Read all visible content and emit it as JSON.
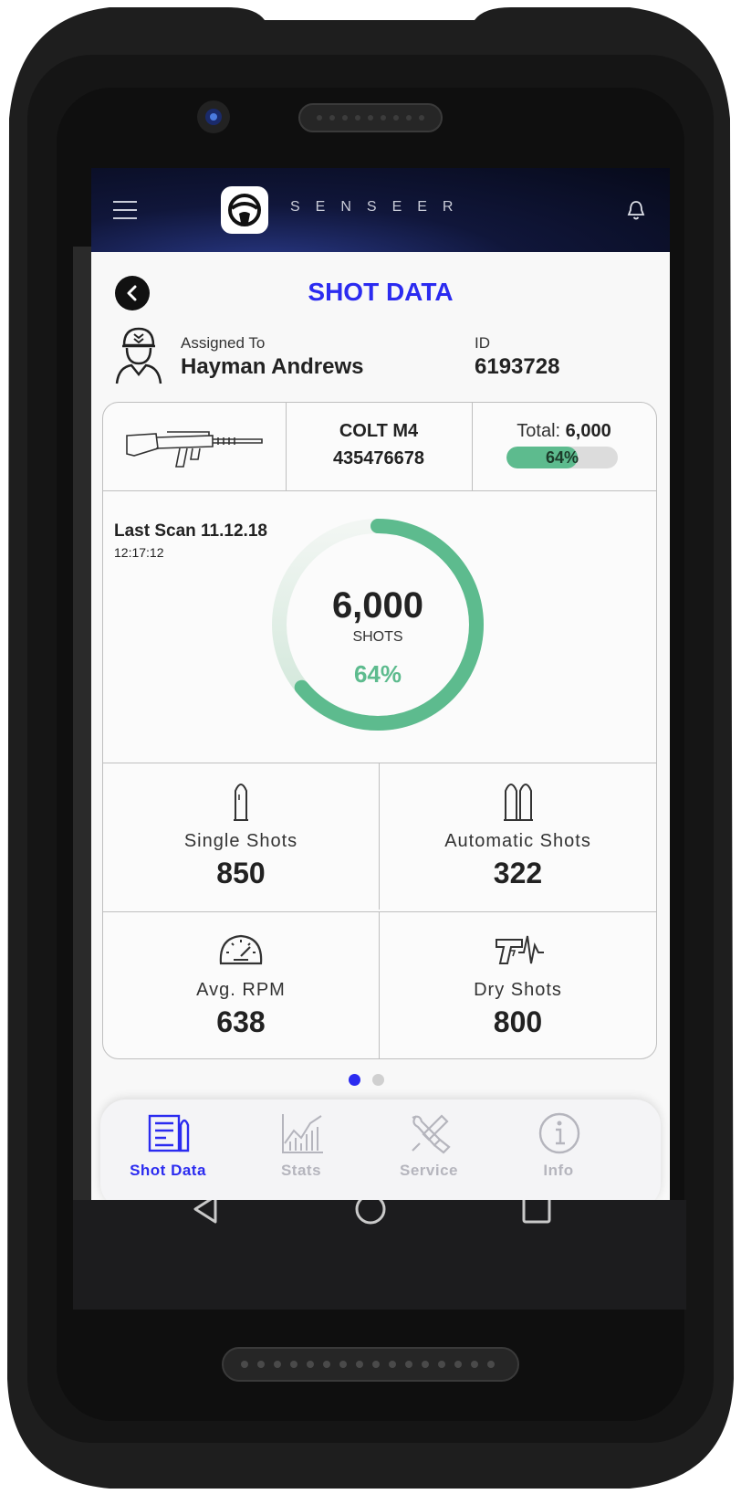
{
  "header": {
    "brand": "SENSEER"
  },
  "page": {
    "title": "SHOT DATA"
  },
  "assigned": {
    "label": "Assigned To",
    "name": "Hayman Andrews",
    "id_label": "ID",
    "id_value": "6193728"
  },
  "weapon": {
    "model": "COLT M4",
    "serial": "435476678",
    "total_label": "Total:",
    "total_value": "6,000",
    "progress_label": "64%",
    "progress": 0.64
  },
  "scan": {
    "title": "Last Scan 11.12.18",
    "time": "12:17:12"
  },
  "ring": {
    "value": "6,000",
    "unit": "SHOTS",
    "percent_label": "64%",
    "percent": 0.64
  },
  "stats": [
    {
      "label": "Single Shots",
      "value": "850",
      "icon": "single-bullet-icon"
    },
    {
      "label": "Automatic Shots",
      "value": "322",
      "icon": "double-bullet-icon"
    },
    {
      "label": "Avg. RPM",
      "value": "638",
      "icon": "speedometer-icon"
    },
    {
      "label": "Dry Shots",
      "value": "800",
      "icon": "pistol-pulse-icon"
    }
  ],
  "pager": {
    "count": 2,
    "active": 1
  },
  "nav": [
    {
      "label": "Shot Data",
      "icon": "shot-data-icon",
      "active": true
    },
    {
      "label": "Stats",
      "icon": "stats-chart-icon",
      "active": false
    },
    {
      "label": "Service",
      "icon": "service-tools-icon",
      "active": false
    },
    {
      "label": "Info",
      "icon": "info-icon",
      "active": false
    }
  ],
  "colors": {
    "accent": "#2b2bf0",
    "green": "#5dbb8e",
    "inactive": "#b5b5bd",
    "frame": "#232323"
  }
}
